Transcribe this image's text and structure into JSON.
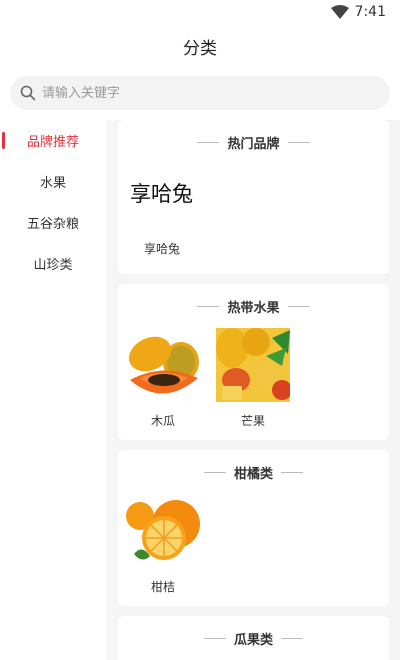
{
  "status_bar": {
    "time": "7:41"
  },
  "header": {
    "title": "分类"
  },
  "search": {
    "placeholder": "请输入关键字"
  },
  "sidebar": {
    "items": [
      {
        "label": "品牌推荐",
        "active": true
      },
      {
        "label": "水果",
        "active": false
      },
      {
        "label": "五谷杂粮",
        "active": false
      },
      {
        "label": "山珍类",
        "active": false
      }
    ]
  },
  "sections": [
    {
      "title": "热门品牌",
      "logo_text": "享哈兔",
      "items": [
        {
          "label": "享哈兔"
        }
      ]
    },
    {
      "title": "热带水果",
      "items": [
        {
          "label": "木瓜",
          "image": "papaya"
        },
        {
          "label": "芒果",
          "image": "mango"
        }
      ]
    },
    {
      "title": "柑橘类",
      "items": [
        {
          "label": "柑桔",
          "image": "orange"
        }
      ]
    },
    {
      "title": "瓜果类",
      "items": []
    }
  ],
  "colors": {
    "accent": "#e0333c",
    "content_bg": "#f5f5f5",
    "search_bg": "#f3f3f3"
  }
}
